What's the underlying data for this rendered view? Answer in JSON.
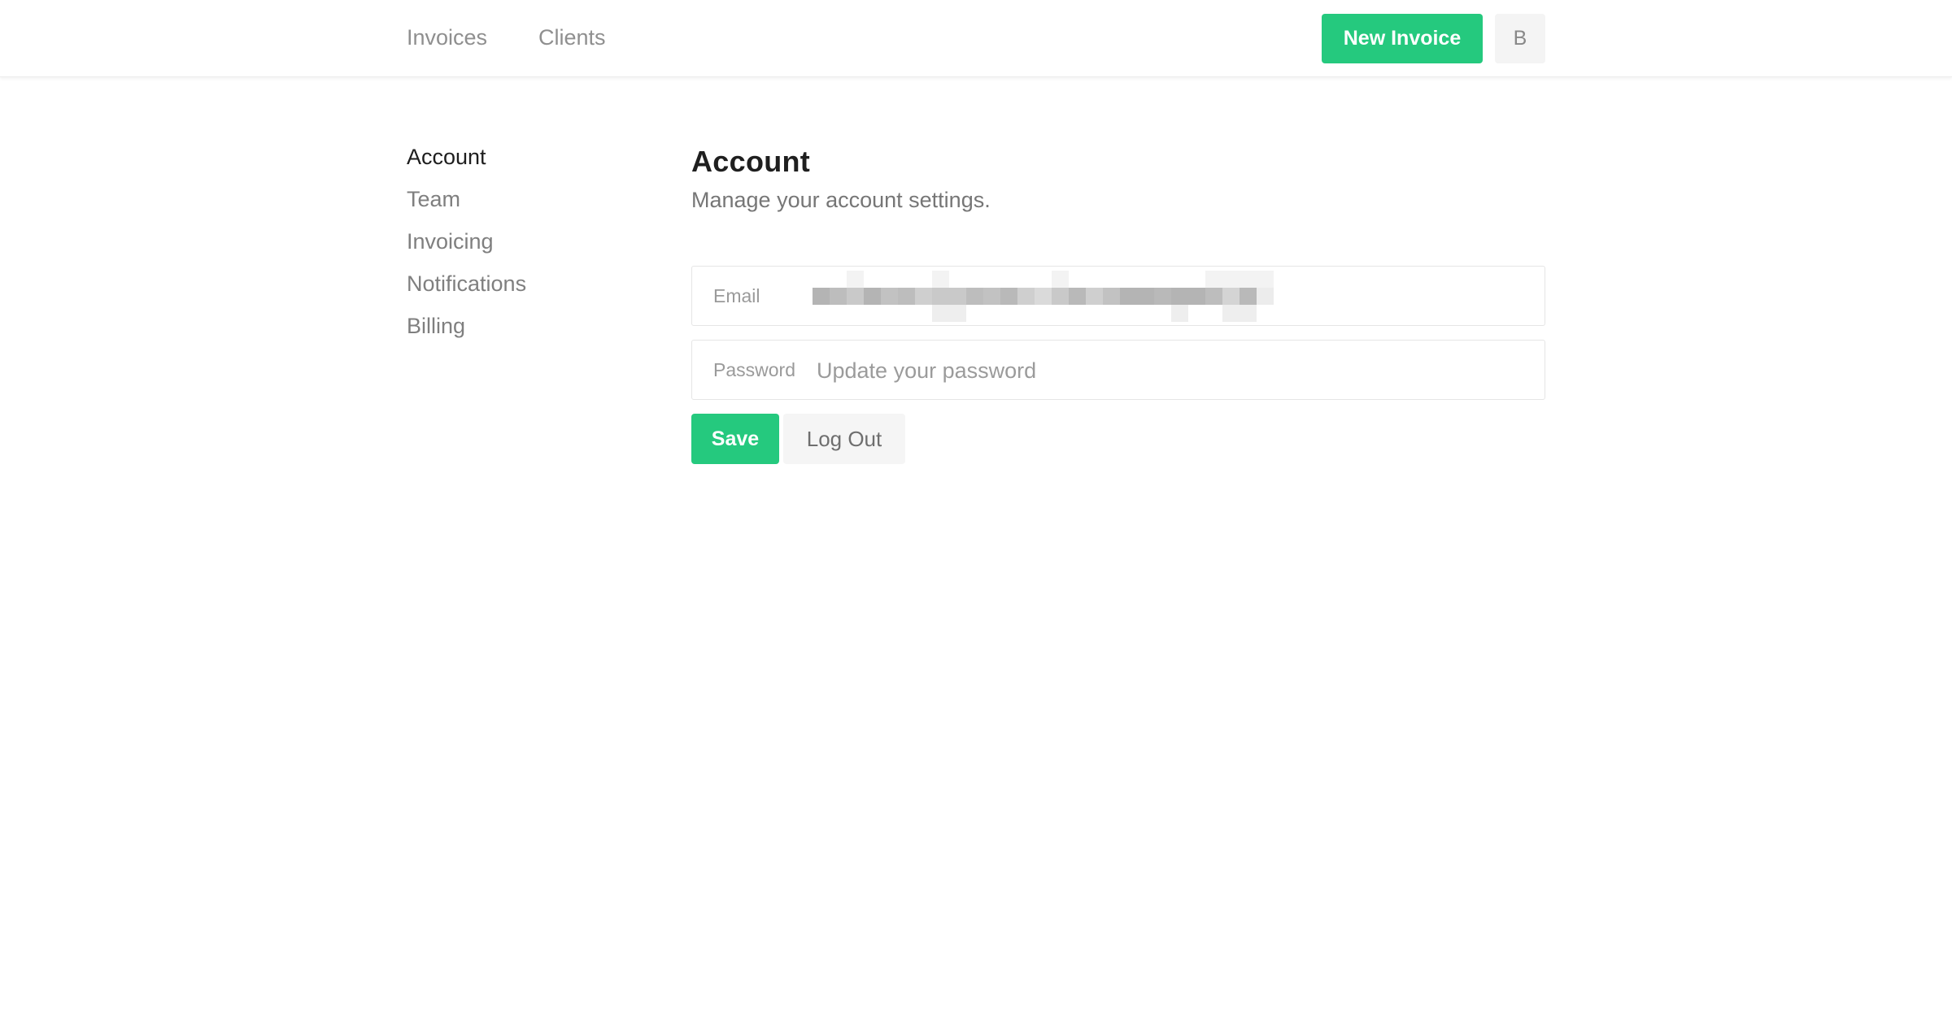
{
  "topnav": {
    "links": [
      {
        "label": "Invoices"
      },
      {
        "label": "Clients"
      }
    ],
    "new_invoice_label": "New Invoice",
    "avatar_initial": "B"
  },
  "sidebar": {
    "items": [
      {
        "label": "Account",
        "active": true
      },
      {
        "label": "Team",
        "active": false
      },
      {
        "label": "Invoicing",
        "active": false
      },
      {
        "label": "Notifications",
        "active": false
      },
      {
        "label": "Billing",
        "active": false
      }
    ]
  },
  "main": {
    "title": "Account",
    "subtitle": "Manage your account settings.",
    "email": {
      "label": "Email",
      "value_redacted": true
    },
    "password": {
      "label": "Password",
      "placeholder": "Update your password"
    },
    "save_label": "Save",
    "logout_label": "Log Out"
  },
  "colors": {
    "accent": "#25c97e",
    "text_dark": "#1f1f1f",
    "text_muted": "#7f7f7f",
    "border": "#e5e5e5"
  },
  "icons": {
    "avatar": "user-initial-avatar"
  }
}
